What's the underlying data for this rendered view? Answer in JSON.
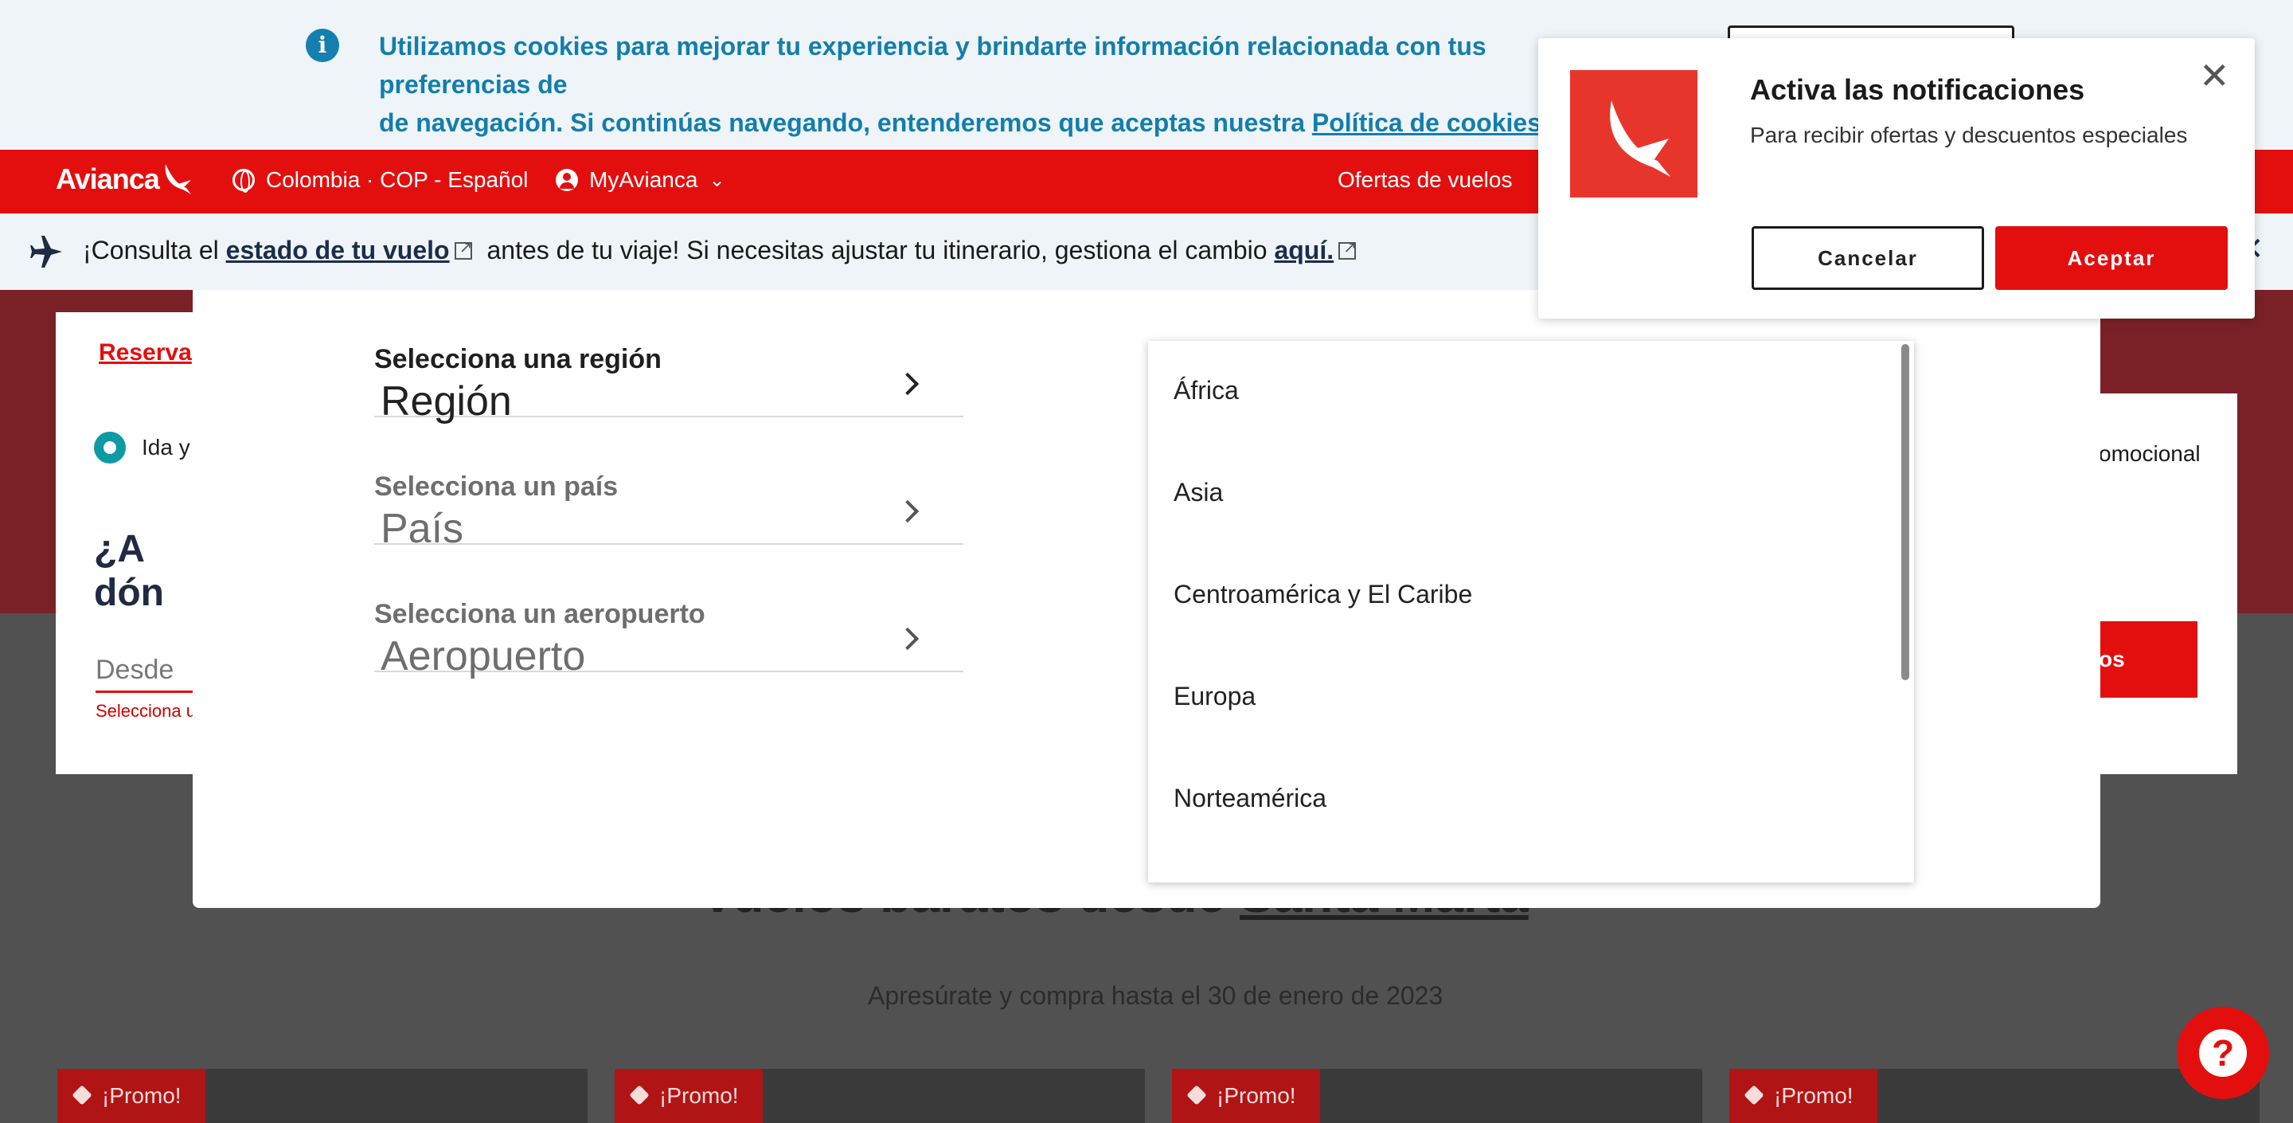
{
  "cookie_banner": {
    "text": "Utilizamos cookies para mejorar tu experiencia y brindarte información relacionada con tus preferencias de",
    "text_line2": "de navegación. Si continúas navegando, entenderemos que aceptas nuestra ",
    "policy_link": "Política de cookies",
    "period": "."
  },
  "nav": {
    "logo": "Avianca",
    "region_selector": "Colombia · COP - Español",
    "account": "MyAvianca",
    "offers": "Ofertas de vuelos",
    "brand_color": "#e30f0f"
  },
  "alert": {
    "prefix": "¡Consulta el ",
    "status_link": "estado de tu vuelo",
    "middle": " antes de tu viaje! Si necesitas ajustar tu itinerario, gestiona el cambio ",
    "here_link": "aquí."
  },
  "background": {
    "tab_label": "Reserva",
    "trip_type": "Ida y",
    "question": "¿A dón",
    "from_placeholder": "Desde",
    "from_error": "Selecciona u",
    "promo_text": "omocional",
    "search_button": "os",
    "section_title_a": "Vuelos baratos desde ",
    "section_title_b": "Santa Marta",
    "section_subtitle": "Apresúrate y compra hasta el 30 de enero de 2023",
    "promo_badges": [
      "¡Promo!",
      "¡Promo!",
      "¡Promo!",
      "¡Promo!"
    ]
  },
  "selector": {
    "fields": [
      {
        "label": "Selecciona una región",
        "value": "Región"
      },
      {
        "label": "Selecciona un país",
        "value": "País"
      },
      {
        "label": "Selecciona un aeropuerto",
        "value": "Aeropuerto"
      }
    ],
    "regions": [
      "África",
      "Asia",
      "Centroamérica y El Caribe",
      "Europa",
      "Norteamérica"
    ]
  },
  "notification": {
    "title": "Activa las notificaciones",
    "subtitle": "Para recibir ofertas y descuentos especiales",
    "cancel": "Cancelar",
    "accept": "Aceptar"
  }
}
